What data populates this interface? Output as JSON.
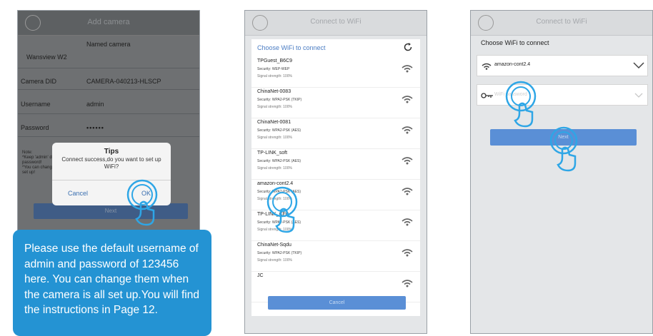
{
  "panel1": {
    "title": "Add camera",
    "named": "Named camera",
    "camera_name": "Wansview W2",
    "camera_did_label": "Camera DID",
    "camera_did_value": "CAMERA-040213-HLSCP",
    "username_label": "Username",
    "username_value": "admin",
    "password_label": "Password",
    "password_value": "••••••",
    "note_line1": "Note:",
    "note_line2": "*Keep 'admin' default password",
    "note_line3": "password!",
    "note_line4": "*You can change after",
    "note_line5": "set up!",
    "next_label": "Next",
    "dialog": {
      "title": "Tips",
      "message": "Connect success,do you want to set up WiFi?",
      "cancel": "Cancel",
      "ok": "OK"
    },
    "callout": "Please use the default username of admin and password of 123456 here. You can change them when the camera is all set up.You will find the instructions in Page 12."
  },
  "panel2": {
    "title": "Connect to WiFi",
    "choose_label": "Choose WiFi to connect",
    "networks": [
      {
        "name": "TPGuest_B6C9",
        "security": "Security: WEP-WEP",
        "signal": "Signal strength: 100%"
      },
      {
        "name": "ChinaNet-0083",
        "security": "Security: WPA2-PSK (TKIP)",
        "signal": "Signal strength: 100%"
      },
      {
        "name": "ChinaNet-0081",
        "security": "Security: WPA2-PSK (AES)",
        "signal": "Signal strength: 100%"
      },
      {
        "name": "TP-LINK_soft",
        "security": "Security: WPA2-PSK (AES)",
        "signal": "Signal strength: 100%"
      },
      {
        "name": "amazon-cont2.4",
        "security": "Security: WPA2-PSK (AES)",
        "signal": "Signal strength: 100%"
      },
      {
        "name": "TP-LINK_CF0",
        "security": "Security: WPA2-PSK (AES)",
        "signal": "Signal strength: 100%"
      },
      {
        "name": "ChinaNet-Sqdu",
        "security": "Security: WPA2-PSK (TKIP)",
        "signal": "Signal strength: 100%"
      },
      {
        "name": "JC",
        "security": "",
        "signal": ""
      }
    ],
    "cancel_label": "Cancel"
  },
  "panel3": {
    "title": "Connect to WiFi",
    "choose_label": "Choose WiFi to connect",
    "ssid_value": "amazon-cont2.4",
    "password_placeholder": "WiFi password",
    "next_label": "Next"
  },
  "colors": {
    "callout": "#2493d3",
    "button": "#5a8fd6",
    "tap_ring": "#2ea6e6",
    "dark_panel": "#6e7072"
  },
  "icons": [
    "back-icon",
    "refresh-icon",
    "wifi-icon",
    "key-icon",
    "chevron-down-icon",
    "tap-hand-icon"
  ]
}
